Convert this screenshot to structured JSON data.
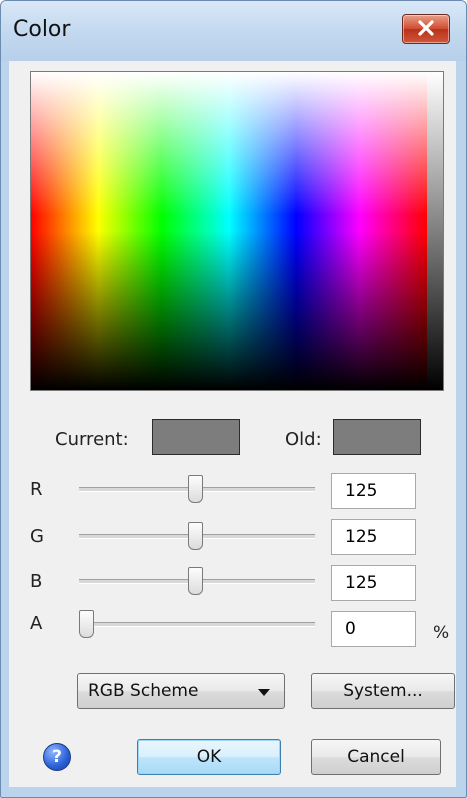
{
  "window": {
    "title": "Color"
  },
  "swatches": {
    "current_label": "Current:",
    "old_label": "Old:",
    "current_color": "#7d7d7d",
    "old_color": "#7d7d7d"
  },
  "channels": [
    {
      "label": "R",
      "value": "125",
      "slider_fraction": 0.49
    },
    {
      "label": "G",
      "value": "125",
      "slider_fraction": 0.49
    },
    {
      "label": "B",
      "value": "125",
      "slider_fraction": 0.49
    },
    {
      "label": "A",
      "value": "0",
      "slider_fraction": 0.0,
      "unit": "%"
    }
  ],
  "scheme": {
    "selected": "RGB Scheme"
  },
  "buttons": {
    "system": "System...",
    "ok": "OK",
    "cancel": "Cancel"
  },
  "icons": {
    "close": "close-icon",
    "help": "help-icon",
    "dropdown": "chevron-down-icon"
  },
  "colors": {
    "title_bg": "#c2d8ef",
    "client_bg": "#f0f0f0",
    "close_btn": "#cf4a2d",
    "primary_btn": "#bee6fd"
  }
}
